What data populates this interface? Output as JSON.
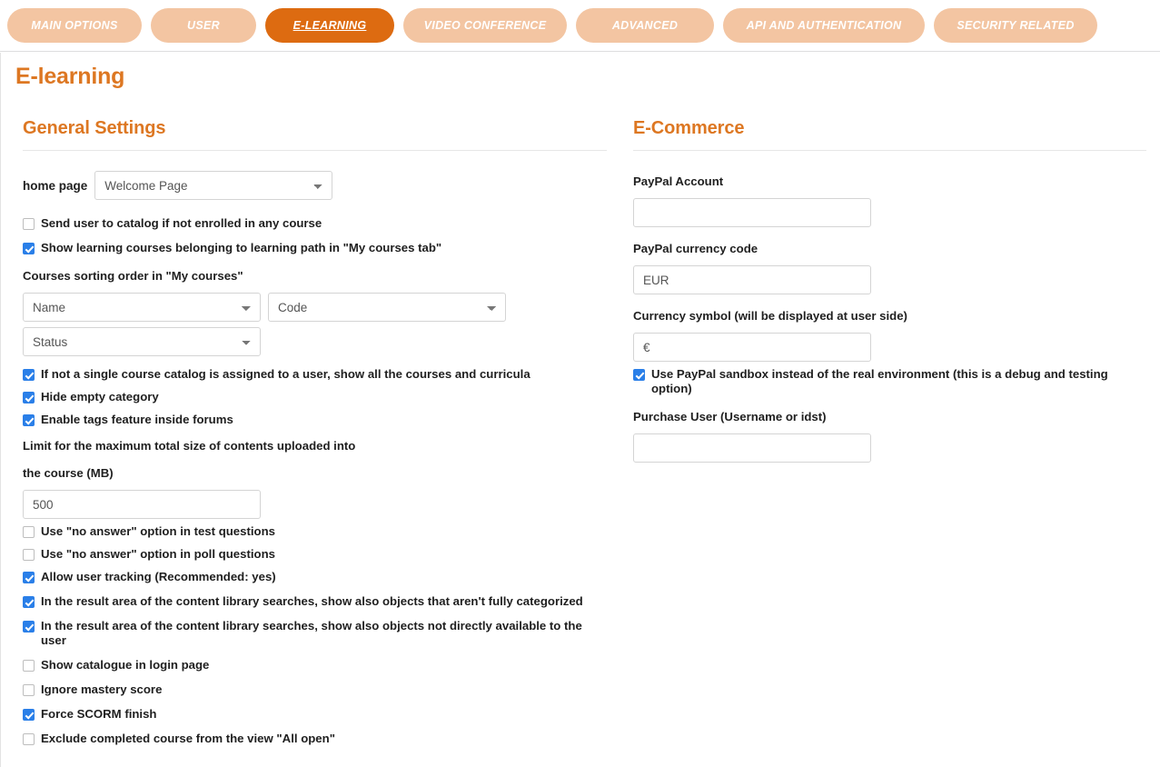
{
  "tabs": [
    {
      "label": "MAIN OPTIONS",
      "active": false
    },
    {
      "label": "USER",
      "active": false
    },
    {
      "label": "E-LEARNING",
      "active": true
    },
    {
      "label": "VIDEO CONFERENCE",
      "active": false
    },
    {
      "label": "ADVANCED",
      "active": false
    },
    {
      "label": "API AND AUTHENTICATION",
      "active": false
    },
    {
      "label": "SECURITY RELATED",
      "active": false
    }
  ],
  "page": {
    "title": "E-learning"
  },
  "colors": {
    "accent_orange": "#dd7722",
    "active_tab": "#dd6b11",
    "inactive_tab": "#f3c5a2",
    "checkbox_checked": "#2a7fe8"
  },
  "general": {
    "section_title": "General Settings",
    "home_page_label": "home page",
    "home_page_value": "Welcome Page",
    "home_page_options": [
      "Welcome Page"
    ],
    "send_to_catalog": {
      "label": "Send user to catalog if not enrolled in any course",
      "checked": false
    },
    "show_learning_courses": {
      "label": "Show learning courses belonging to learning path in \"My courses tab\"",
      "checked": true
    },
    "sorting_label": "Courses sorting order in \"My courses\"",
    "sort_selects": [
      {
        "value": "Name",
        "options": [
          "Name"
        ]
      },
      {
        "value": "Code",
        "options": [
          "Code"
        ]
      },
      {
        "value": "Status",
        "options": [
          "Status"
        ]
      }
    ],
    "checkboxes_mid": [
      {
        "label": "If not a single course catalog is assigned to a user, show all the courses and curricula",
        "checked": true
      },
      {
        "label": "Hide empty category",
        "checked": true
      },
      {
        "label": "Enable tags feature inside forums",
        "checked": true
      }
    ],
    "limit_label_line1": "Limit for the maximum total size of contents uploaded into",
    "limit_label_line2": "the course (MB)",
    "limit_value": "500",
    "checkboxes_bottom": [
      {
        "label": "Use \"no answer\" option in test questions",
        "checked": false
      },
      {
        "label": "Use \"no answer\" option in poll questions",
        "checked": false
      },
      {
        "label": "Allow user tracking (Recommended: yes)",
        "checked": true
      },
      {
        "label": "In the result area of the content library searches, show also objects that aren't fully categorized",
        "checked": true
      },
      {
        "label": "In the result area of the content library searches, show also objects not directly available to the user",
        "checked": true
      },
      {
        "label": "Show catalogue in login page",
        "checked": false
      },
      {
        "label": "Ignore mastery score",
        "checked": false
      },
      {
        "label": "Force SCORM finish",
        "checked": true
      },
      {
        "label": "Exclude completed course from the view \"All open\"",
        "checked": false
      }
    ]
  },
  "ecommerce": {
    "section_title": "E-Commerce",
    "paypal_account_label": "PayPal Account",
    "paypal_account_value": "",
    "paypal_currency_label": "PayPal currency code",
    "paypal_currency_value": "EUR",
    "currency_symbol_label": "Currency symbol (will be displayed at user side)",
    "currency_symbol_value": "€",
    "sandbox": {
      "label": "Use PayPal sandbox instead of the real environment (this is a debug and testing option)",
      "checked": true
    },
    "purchase_user_label": "Purchase User (Username or idst)",
    "purchase_user_value": ""
  }
}
